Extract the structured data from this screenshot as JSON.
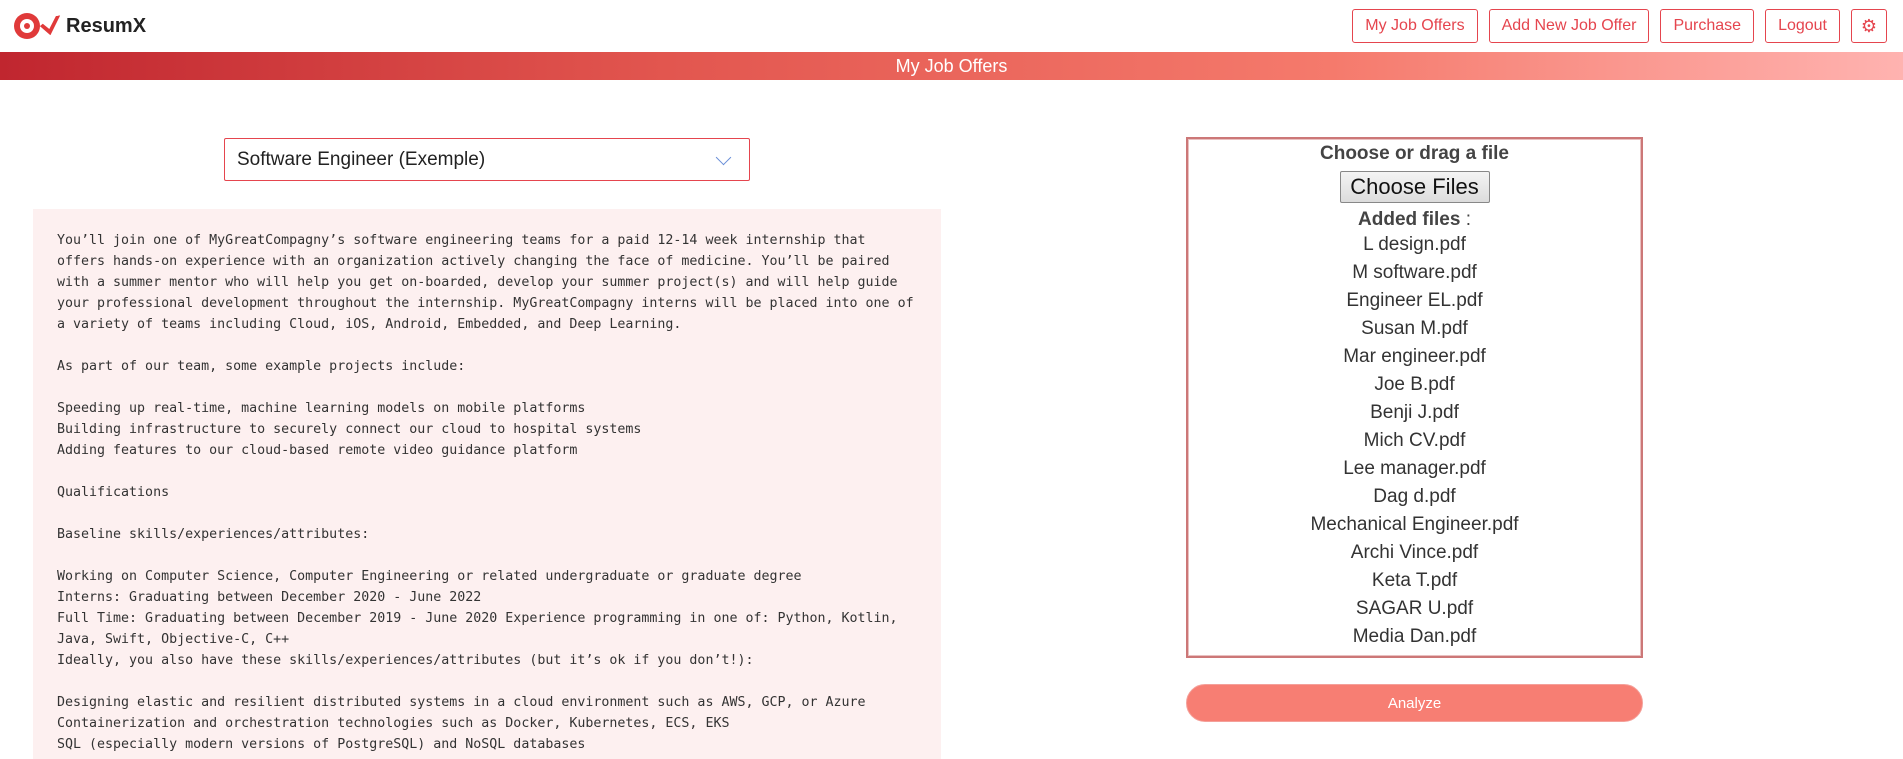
{
  "app": {
    "name": "ResumX"
  },
  "nav": {
    "items": [
      "My Job Offers",
      "Add New Job Offer",
      "Purchase",
      "Logout"
    ],
    "settings_icon": "gear-icon"
  },
  "page_title": "My Job Offers",
  "job_select": {
    "selected": "Software Engineer (Exemple)"
  },
  "description": "You’ll join one of MyGreatCompagny’s software engineering teams for a paid 12-14 week internship that\noffers hands-on experience with an organization actively changing the face of medicine. You’ll be paired\nwith a summer mentor who will help you get on-boarded, develop your summer project(s) and will help guide\nyour professional development throughout the internship. MyGreatCompagny interns will be placed into one of\na variety of teams including Cloud, iOS, Android, Embedded, and Deep Learning.\n\nAs part of our team, some example projects include:\n\nSpeeding up real-time, machine learning models on mobile platforms\nBuilding infrastructure to securely connect our cloud to hospital systems\nAdding features to our cloud-based remote video guidance platform\n\nQualifications\n\nBaseline skills/experiences/attributes:\n\nWorking on Computer Science, Computer Engineering or related undergraduate or graduate degree\nInterns: Graduating between December 2020 - June 2022\nFull Time: Graduating between December 2019 - June 2020 Experience programming in one of: Python, Kotlin,\nJava, Swift, Objective-C, C++\nIdeally, you also have these skills/experiences/attributes (but it’s ok if you don’t!):\n\nDesigning elastic and resilient distributed systems in a cloud environment such as AWS, GCP, or Azure\nContainerization and orchestration technologies such as Docker, Kubernetes, ECS, EKS\nSQL (especially modern versions of PostgreSQL) and NoSQL databases",
  "upload": {
    "title": "Choose or drag a file",
    "button_label": "Choose Files",
    "added_label": "Added files",
    "added_suffix": " :",
    "files": [
      "L design.pdf",
      "M software.pdf",
      "Engineer EL.pdf",
      "Susan M.pdf",
      "Mar engineer.pdf",
      "Joe B.pdf",
      "Benji J.pdf",
      "Mich CV.pdf",
      "Lee manager.pdf",
      "Dag d.pdf",
      "Mechanical Engineer.pdf",
      "Archi Vince.pdf",
      "Keta T.pdf",
      "SAGAR U.pdf",
      "Media Dan.pdf"
    ]
  },
  "analyze_label": "Analyze",
  "colors": {
    "accent": "#e5454e",
    "analyze": "#f77e73"
  }
}
